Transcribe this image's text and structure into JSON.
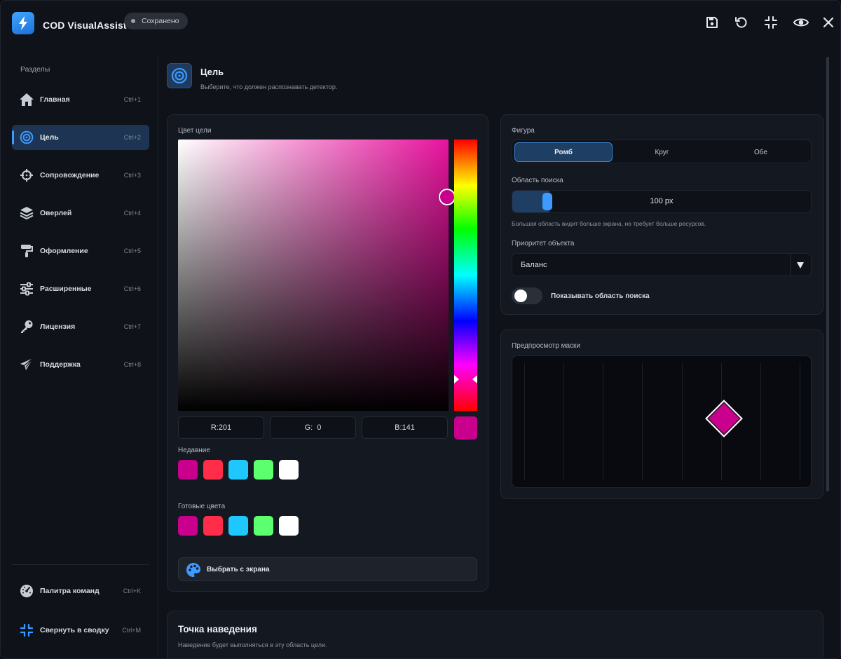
{
  "app": {
    "title": "COD VisualAssist",
    "status_badge": "Сохранено"
  },
  "titlebar_icons": [
    "save-icon",
    "undo-icon",
    "collapse-icon",
    "eye-icon",
    "close-icon"
  ],
  "sidebar": {
    "section_label": "Разделы",
    "items": [
      {
        "label": "Главная",
        "shortcut": "Ctrl+1",
        "icon": "home-icon"
      },
      {
        "label": "Цель",
        "shortcut": "Ctrl+2",
        "icon": "target-icon",
        "active": true
      },
      {
        "label": "Сопровождение",
        "shortcut": "Ctrl+3",
        "icon": "crosshair-icon"
      },
      {
        "label": "Оверлей",
        "shortcut": "Ctrl+4",
        "icon": "layers-icon"
      },
      {
        "label": "Оформление",
        "shortcut": "Ctrl+5",
        "icon": "paint-roller-icon"
      },
      {
        "label": "Расширенные",
        "shortcut": "Ctrl+6",
        "icon": "sliders-icon"
      },
      {
        "label": "Лицензия",
        "shortcut": "Ctrl+7",
        "icon": "key-icon"
      },
      {
        "label": "Поддержка",
        "shortcut": "Ctrl+8",
        "icon": "paper-plane-icon"
      }
    ],
    "footer_items": [
      {
        "label": "Палитра команд",
        "shortcut": "Ctrl+K",
        "icon": "gauge-icon"
      },
      {
        "label": "Свернуть в сводку",
        "shortcut": "Ctrl+M",
        "icon": "collapse-icon"
      }
    ]
  },
  "page": {
    "title": "Цель",
    "subtitle": "Выберите, что должен распознавать детектор.",
    "icon": "target-icon"
  },
  "color_card": {
    "label": "Цвет цели",
    "rgb": {
      "r": "R:201",
      "g": "G:  0",
      "b": "B:141"
    },
    "current_color": "#c9008d",
    "recent_label": "Недавние",
    "recent_colors": [
      "#c9008d",
      "#ff2d4a",
      "#1ec8ff",
      "#5cff6e",
      "#ffffff"
    ],
    "preset_label": "Готовые цвета",
    "preset_colors": [
      "#c9008d",
      "#ff2d4a",
      "#1ec8ff",
      "#5cff6e",
      "#ffffff"
    ],
    "pick_button": "Выбрать с экрана"
  },
  "shape_card": {
    "figure_label": "Фигура",
    "figure_options": [
      "Ромб",
      "Круг",
      "Обе"
    ],
    "figure_selected": "Ромб",
    "search_area_label": "Область поиска",
    "search_area_value": "100 px",
    "search_area_level": 0.08,
    "search_area_hint": "Большая область видит больше экрана, но требует больше ресурсов.",
    "priority_label": "Приоритет объекта",
    "priority_value": "Баланс",
    "toggle_label": "Показывать область поиска",
    "toggle_on": false
  },
  "preview_card": {
    "label": "Предпросмотр маски"
  },
  "hover_card": {
    "title": "Точка наведения",
    "subtitle": "Наведение будет выполняться в эту область цели."
  },
  "colors": {
    "accent": "#3d9bff",
    "target": "#c9008d",
    "background": "#0f1218"
  }
}
